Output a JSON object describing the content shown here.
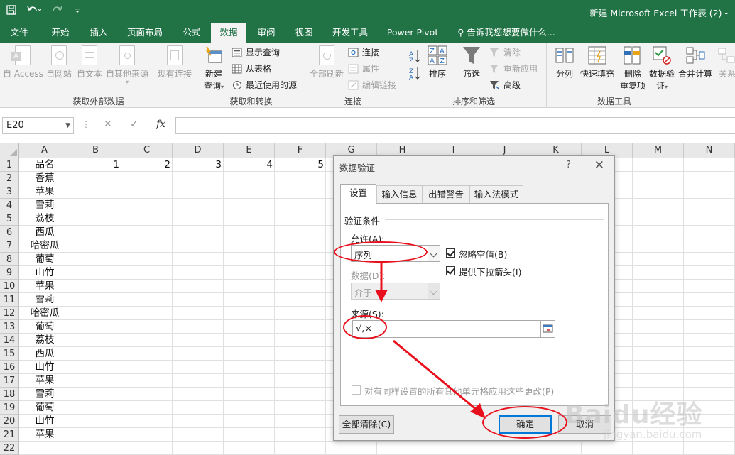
{
  "titlebar": {
    "title": "新建 Microsoft Excel 工作表 (2) -"
  },
  "tabs": [
    "文件",
    "开始",
    "插入",
    "页面布局",
    "公式",
    "数据",
    "审阅",
    "视图",
    "开发工具",
    "Power Pivot",
    "♀ 告诉我您想要做什么..."
  ],
  "ribbon": {
    "group1": {
      "label": "获取外部数据",
      "buttons": [
        "自 Access",
        "自网站",
        "自文本",
        "自其他来源",
        "现有连接"
      ]
    },
    "group2": {
      "label": "获取和转换",
      "big": [
        "新建",
        "查询"
      ],
      "small": [
        "显示查询",
        "从表格",
        "最近使用的源"
      ]
    },
    "group3": {
      "label": "连接",
      "big": "全部刷新",
      "small": [
        "连接",
        "属性",
        "编辑链接"
      ]
    },
    "group4": {
      "label": "排序和筛选",
      "buttons": [
        "排序",
        "筛选"
      ],
      "small": [
        "清除",
        "重新应用",
        "高级"
      ]
    },
    "group5": {
      "label": "数据工具",
      "buttons": [
        "分列",
        "快速填充",
        "删除",
        "重复项",
        "数据验",
        "证",
        "合并计算",
        "关系"
      ]
    }
  },
  "formula_bar": {
    "name_box": "E20",
    "fx": "fx",
    "formula": ""
  },
  "sheet": {
    "columns": [
      "A",
      "B",
      "C",
      "D",
      "E",
      "F",
      "G",
      "H",
      "I",
      "J",
      "K",
      "L",
      "M",
      "N"
    ],
    "rows": [
      "1",
      "2",
      "3",
      "4",
      "5",
      "6",
      "7",
      "8",
      "9",
      "10",
      "11",
      "12",
      "13",
      "14",
      "15",
      "16",
      "17",
      "18",
      "19",
      "20",
      "21",
      "22"
    ],
    "col_a": [
      "品名",
      "香蕉",
      "苹果",
      "雪莉",
      "荔枝",
      "西瓜",
      "哈密瓜",
      "葡萄",
      "山竹",
      "苹果",
      "雪莉",
      "哈密瓜",
      "葡萄",
      "荔枝",
      "西瓜",
      "山竹",
      "苹果",
      "雪莉",
      "葡萄",
      "山竹",
      "苹果",
      ""
    ],
    "row1_numbers": [
      "1",
      "2",
      "3",
      "4",
      "5"
    ]
  },
  "dialog": {
    "title": "数据验证",
    "help": "?",
    "close": "✕",
    "tabs": [
      "设置",
      "输入信息",
      "出错警告",
      "输入法模式"
    ],
    "section": "验证条件",
    "allow_label": "允许(A):",
    "allow_value": "序列",
    "ignore_blank": "忽略空值(B)",
    "dropdown_arrow": "提供下拉箭头(I)",
    "data_label": "数据(D):",
    "data_value": "介于",
    "source_label": "来源(S):",
    "source_value": "√,×",
    "apply_all": "对有同样设置的所有其他单元格应用这些更改(P)",
    "clear_all": "全部清除(C)",
    "ok": "确定",
    "cancel": "取消"
  },
  "watermark": {
    "brand": "Baidu经验",
    "url": "jingyan.baidu.com"
  },
  "colors": {
    "excel_green": "#217346",
    "annotation_red": "#e8101c",
    "focus_blue": "#0078d7"
  }
}
